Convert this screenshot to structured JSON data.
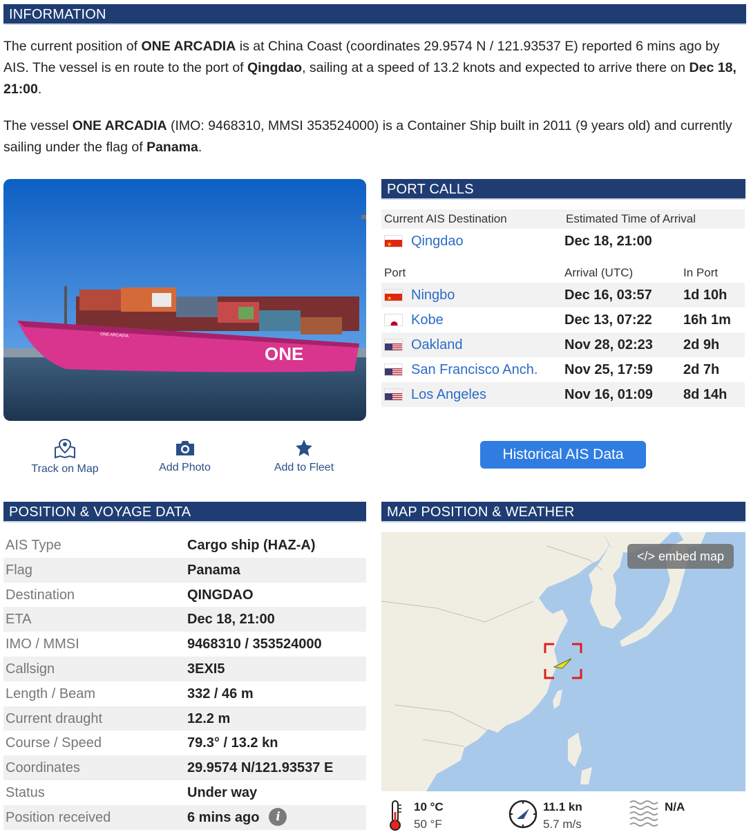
{
  "information": {
    "header": "INFORMATION",
    "p1_a": "The current position of ",
    "p1_vessel": "ONE ARCADIA",
    "p1_b": " is at China Coast (coordinates 29.9574 N / 121.93537 E) reported 6 mins ago by AIS. The vessel is en route to the port of ",
    "p1_port": "Qingdao",
    "p1_c": ", sailing at a speed of 13.2 knots and expected to arrive there on ",
    "p1_eta": "Dec 18, 21:00",
    "p1_d": ".",
    "p2_a": "The vessel ",
    "p2_vessel": "ONE ARCADIA",
    "p2_b": " (IMO: 9468310, MMSI 353524000) is a Container Ship built in 2011 (9 years old) and currently sailing under the flag of ",
    "p2_flag": "Panama",
    "p2_c": "."
  },
  "photo": {
    "hull_text": "ONE ARCADIA",
    "logo_text": "ONE"
  },
  "actions": {
    "track": "Track on Map",
    "photo": "Add Photo",
    "fleet": "Add to Fleet"
  },
  "port_calls": {
    "header": "PORT CALLS",
    "dest_col": "Current AIS Destination",
    "eta_col": "Estimated Time of Arrival",
    "destination": {
      "port": "Qingdao",
      "flag": "cn",
      "eta": "Dec 18, 21:00"
    },
    "port_col": "Port",
    "arrival_col": "Arrival (UTC)",
    "inport_col": "In Port",
    "calls": [
      {
        "port": "Ningbo",
        "flag": "cn",
        "arrival": "Dec 16, 03:57",
        "in_port": "1d 10h"
      },
      {
        "port": "Kobe",
        "flag": "jp",
        "arrival": "Dec 13, 07:22",
        "in_port": "16h 1m"
      },
      {
        "port": "Oakland",
        "flag": "us",
        "arrival": "Nov 28, 02:23",
        "in_port": "2d 9h"
      },
      {
        "port": "San Francisco Anch.",
        "flag": "us",
        "arrival": "Nov 25, 17:59",
        "in_port": "2d 7h"
      },
      {
        "port": "Los Angeles",
        "flag": "us",
        "arrival": "Nov 16, 01:09",
        "in_port": "8d 14h"
      }
    ],
    "historical_button": "Historical AIS Data"
  },
  "voyage": {
    "header": "POSITION & VOYAGE DATA",
    "rows": [
      {
        "key": "AIS Type",
        "value": "Cargo ship (HAZ-A)"
      },
      {
        "key": "Flag",
        "value": "Panama"
      },
      {
        "key": "Destination",
        "value": "QINGDAO"
      },
      {
        "key": "ETA",
        "value": "Dec 18, 21:00"
      },
      {
        "key": "IMO / MMSI",
        "value": "9468310 / 353524000"
      },
      {
        "key": "Callsign",
        "value": "3EXI5"
      },
      {
        "key": "Length / Beam",
        "value": "332 / 46 m"
      },
      {
        "key": "Current draught",
        "value": "12.2 m"
      },
      {
        "key": "Course / Speed",
        "value": "79.3° / 13.2 kn"
      },
      {
        "key": "Coordinates",
        "value": "29.9574 N/121.93537 E"
      },
      {
        "key": "Status",
        "value": "Under way"
      },
      {
        "key": "Position received",
        "value": "6 mins ago"
      }
    ],
    "info_icon": "i"
  },
  "map": {
    "header": "MAP POSITION & WEATHER",
    "embed": "</> embed map"
  },
  "weather": {
    "temp_c": "10 °C",
    "temp_f": "50 °F",
    "wind_kn": "11.1 kn",
    "wind_ms": "5.7 m/s",
    "waves": "N/A"
  },
  "colors": {
    "header_bg": "#1f3d73",
    "link": "#2b6cc9",
    "button": "#2f7de1",
    "hull": "#d9358f"
  }
}
